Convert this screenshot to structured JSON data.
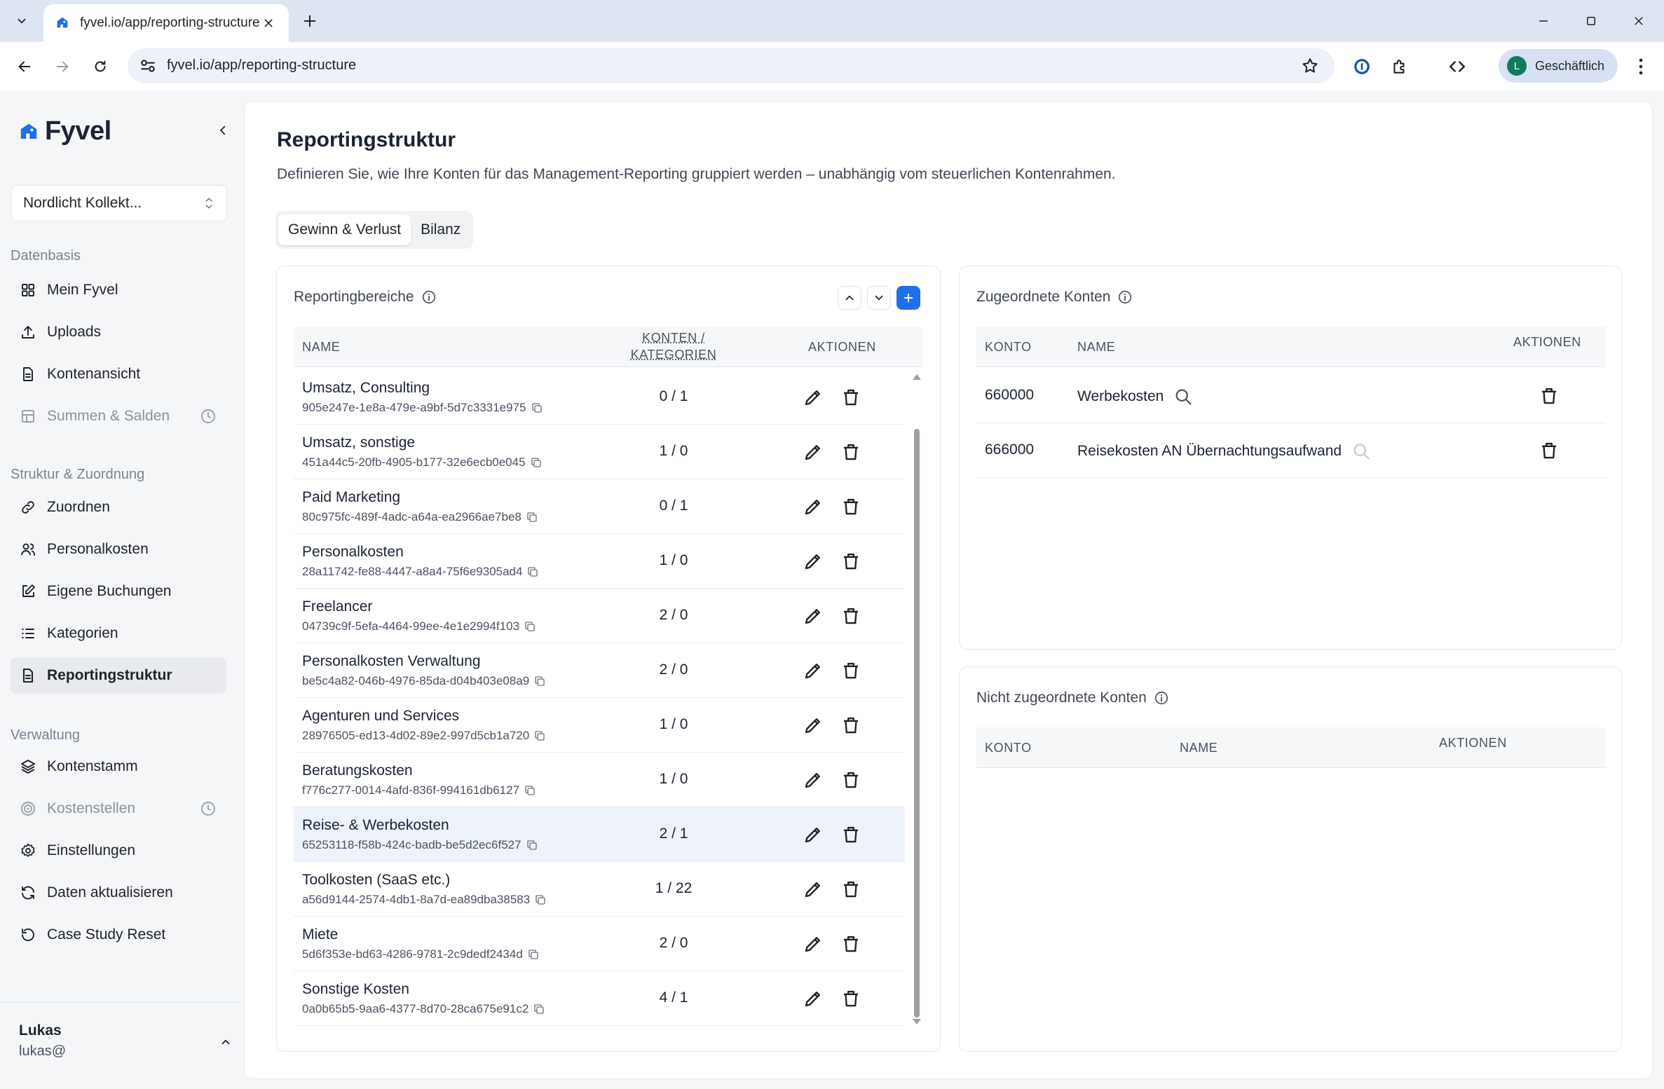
{
  "browser": {
    "tab_title": "fyvel.io/app/reporting-structure",
    "url": "fyvel.io/app/reporting-structure",
    "profile_initial": "L",
    "profile_label": "Geschäftlich"
  },
  "sidebar": {
    "brand": "Fyvel",
    "org": "Nordlicht Kollekt...",
    "sections": [
      {
        "title": "Datenbasis"
      },
      {
        "title": "Struktur & Zuordnung"
      },
      {
        "title": "Verwaltung"
      }
    ],
    "items": [
      {
        "label": "Mein Fyvel",
        "icon": "grid-icon"
      },
      {
        "label": "Uploads",
        "icon": "upload-icon"
      },
      {
        "label": "Kontenansicht",
        "icon": "document-icon"
      },
      {
        "label": "Summen & Salden",
        "icon": "table-icon",
        "disabled": true
      },
      {
        "label": "Zuordnen",
        "icon": "link-icon"
      },
      {
        "label": "Personalkosten",
        "icon": "users-icon"
      },
      {
        "label": "Eigene Buchungen",
        "icon": "edit-icon"
      },
      {
        "label": "Kategorien",
        "icon": "list-icon"
      },
      {
        "label": "Reportingstruktur",
        "icon": "file-icon",
        "active": true
      },
      {
        "label": "Kontenstamm",
        "icon": "layers-icon"
      },
      {
        "label": "Kostenstellen",
        "icon": "target-icon",
        "disabled": true
      },
      {
        "label": "Einstellungen",
        "icon": "gear-icon"
      },
      {
        "label": "Daten aktualisieren",
        "icon": "refresh-icon"
      },
      {
        "label": "Case Study Reset",
        "icon": "reset-icon"
      }
    ],
    "user": {
      "name": "Lukas",
      "email": "lukas@"
    }
  },
  "page": {
    "title": "Reportingstruktur",
    "description": "Definieren Sie, wie Ihre Konten für das Management-Reporting gruppiert werden – unabhängig vom steuerlichen Kontenrahmen.",
    "tabs": [
      {
        "label": "Gewinn & Verlust",
        "active": true
      },
      {
        "label": "Bilanz",
        "active": false
      }
    ]
  },
  "areas": {
    "title": "Reportingbereiche",
    "columns": {
      "name": "NAME",
      "counts_line1": "KONTEN /",
      "counts_line2": "KATEGORIEN",
      "actions": "AKTIONEN"
    },
    "rows": [
      {
        "name": "Umsatz, Consulting",
        "id": "905e247e-1e8a-479e-a9bf-5d7c3331e975",
        "count": "0 / 1"
      },
      {
        "name": "Umsatz, sonstige",
        "id": "451a44c5-20fb-4905-b177-32e6ecb0e045",
        "count": "1 / 0"
      },
      {
        "name": "Paid Marketing",
        "id": "80c975fc-489f-4adc-a64a-ea2966ae7be8",
        "count": "0 / 1"
      },
      {
        "name": "Personalkosten",
        "id": "28a11742-fe88-4447-a8a4-75f6e9305ad4",
        "count": "1 / 0"
      },
      {
        "name": "Freelancer",
        "id": "04739c9f-5efa-4464-99ee-4e1e2994f103",
        "count": "2 / 0"
      },
      {
        "name": "Personalkosten Verwaltung",
        "id": "be5c4a82-046b-4976-85da-d04b403e08a9",
        "count": "2 / 0"
      },
      {
        "name": "Agenturen und Services",
        "id": "28976505-ed13-4d02-89e2-997d5cb1a720",
        "count": "1 / 0"
      },
      {
        "name": "Beratungskosten",
        "id": "f776c277-0014-4afd-836f-994161db6127",
        "count": "1 / 0"
      },
      {
        "name": "Reise- & Werbekosten",
        "id": "65253118-f58b-424c-badb-be5d2ec6f527",
        "count": "2 / 1",
        "highlight": true
      },
      {
        "name": "Toolkosten (SaaS etc.)",
        "id": "a56d9144-2574-4db1-8a7d-ea89dba38583",
        "count": "1 / 22"
      },
      {
        "name": "Miete",
        "id": "5d6f353e-bd63-4286-9781-2c9dedf2434d",
        "count": "2 / 0"
      },
      {
        "name": "Sonstige Kosten",
        "id": "0a0b65b5-9aa6-4377-8d70-28ca675e91c2",
        "count": "4 / 1"
      }
    ]
  },
  "assigned": {
    "title": "Zugeordnete Konten",
    "columns": {
      "konto": "KONTO",
      "name": "NAME",
      "actions": "AKTIONEN"
    },
    "rows": [
      {
        "konto": "660000",
        "name": "Werbekosten"
      },
      {
        "konto": "666000",
        "name": "Reisekosten AN Übernachtungsaufwand"
      }
    ]
  },
  "unassigned": {
    "title": "Nicht zugeordnete Konten",
    "columns": {
      "konto": "KONTO",
      "name": "NAME",
      "actions": "AKTIONEN"
    }
  },
  "colors": {
    "accent": "#1e6fe8",
    "brand": "#1e6fe8",
    "active_nav": "#e8eaee",
    "highlight_row": "#eef3fb"
  }
}
